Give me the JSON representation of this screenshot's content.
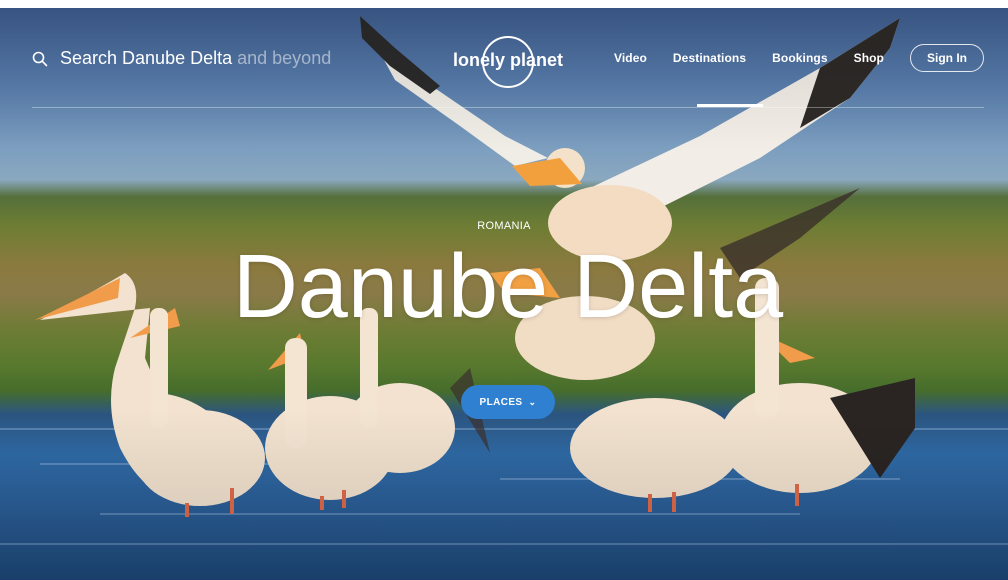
{
  "search": {
    "placeholder": "Search Danube Delta and beyond",
    "main": "Search Danube Delta",
    "dim": "and beyond"
  },
  "logo": {
    "text": "lonely planet"
  },
  "nav": [
    {
      "label": "Video"
    },
    {
      "label": "Destinations",
      "active": true
    },
    {
      "label": "Bookings"
    },
    {
      "label": "Shop"
    }
  ],
  "signin_label": "Sign In",
  "hero": {
    "country": "ROMANIA",
    "title": "Danube Delta",
    "places_label": "PLACES"
  },
  "colors": {
    "accent": "#2f80d1",
    "text": "#ffffff"
  }
}
